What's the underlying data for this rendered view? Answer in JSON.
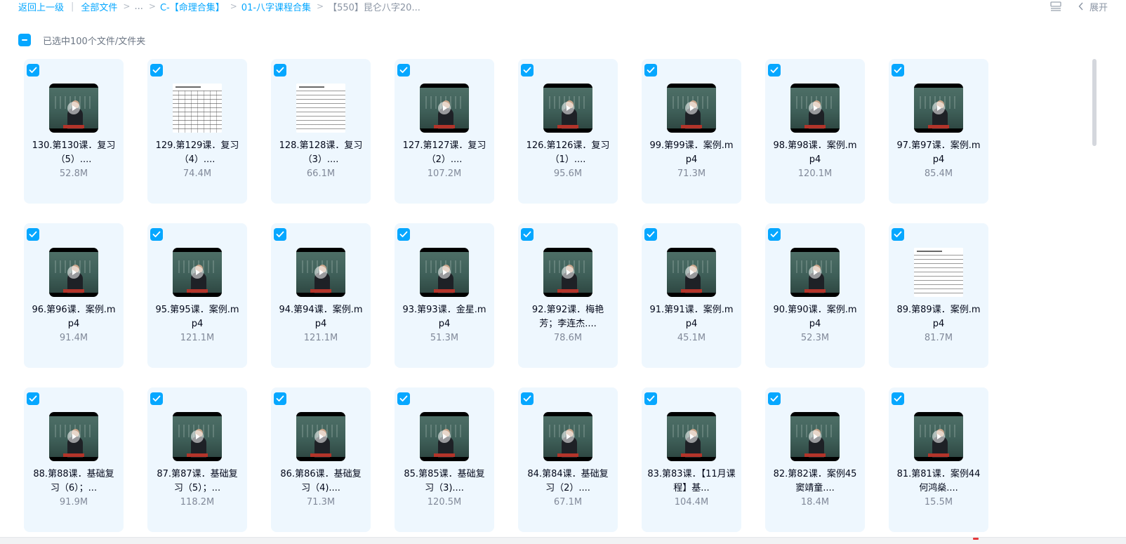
{
  "breadcrumb": {
    "back": "返回上一级",
    "all_files": "全部文件",
    "ellipsis": "...",
    "c1": "C-【命理合集】",
    "c2": "01-八字课程合集",
    "current": "【550】昆仑八字20..."
  },
  "toolbar": {
    "list_view_icon": "list-view-icon",
    "expand_label": "展开",
    "chevron_icon": "chevron-left-icon"
  },
  "selection": {
    "label": "已选中100个文件/文件夹",
    "selected": true
  },
  "colors": {
    "accent": "#06a7ff",
    "card_bg": "#eef7fe",
    "text": "#03081a",
    "muted": "#818999"
  },
  "files": [
    {
      "name": "130.第130课．复习（5）....",
      "size": "52.8M",
      "kind": "video"
    },
    {
      "name": "129.第129课．复习（4）....",
      "size": "74.4M",
      "kind": "doc-table"
    },
    {
      "name": "128.第128课．复习（3）....",
      "size": "66.1M",
      "kind": "doc"
    },
    {
      "name": "127.第127课．复习（2）....",
      "size": "107.2M",
      "kind": "video"
    },
    {
      "name": "126.第126课．复习（1）....",
      "size": "95.6M",
      "kind": "video"
    },
    {
      "name": "99.第99课．案例.mp4",
      "size": "71.3M",
      "kind": "video"
    },
    {
      "name": "98.第98课．案例.mp4",
      "size": "120.1M",
      "kind": "video"
    },
    {
      "name": "97.第97课．案例.mp4",
      "size": "85.4M",
      "kind": "video"
    },
    {
      "name": "96.第96课．案例.mp4",
      "size": "91.4M",
      "kind": "video"
    },
    {
      "name": "95.第95课．案例.mp4",
      "size": "121.1M",
      "kind": "video"
    },
    {
      "name": "94.第94课．案例.mp4",
      "size": "121.1M",
      "kind": "video"
    },
    {
      "name": "93.第93课．金星.mp4",
      "size": "51.3M",
      "kind": "video"
    },
    {
      "name": "92.第92课．梅艳芳；李连杰....",
      "size": "78.6M",
      "kind": "video"
    },
    {
      "name": "91.第91课．案例.mp4",
      "size": "45.1M",
      "kind": "video"
    },
    {
      "name": "90.第90课．案例.mp4",
      "size": "52.3M",
      "kind": "video"
    },
    {
      "name": "89.第89课．案例.mp4",
      "size": "81.7M",
      "kind": "doc"
    },
    {
      "name": "88.第88课．基础复习（6）；...",
      "size": "91.9M",
      "kind": "video"
    },
    {
      "name": "87.第87课．基础复习（5）；...",
      "size": "118.2M",
      "kind": "video"
    },
    {
      "name": "86.第86课．基础复习（4)....",
      "size": "71.3M",
      "kind": "video"
    },
    {
      "name": "85.第85课．基础复习（3)....",
      "size": "120.5M",
      "kind": "video"
    },
    {
      "name": "84.第84课．基础复习（2）....",
      "size": "67.1M",
      "kind": "video"
    },
    {
      "name": "83.第83课．【11月课程】基...",
      "size": "104.4M",
      "kind": "video"
    },
    {
      "name": "82.第82课．案例45窦靖童....",
      "size": "18.4M",
      "kind": "video"
    },
    {
      "name": "81.第81课．案例44何鸿燊....",
      "size": "15.5M",
      "kind": "video"
    }
  ]
}
